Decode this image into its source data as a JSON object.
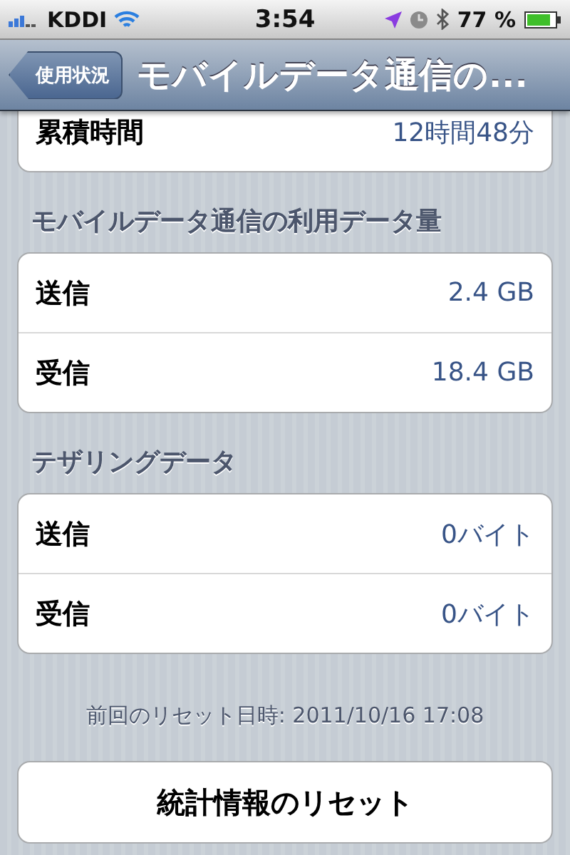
{
  "status_bar": {
    "carrier": "KDDI",
    "time": "3:54",
    "battery": "77 %"
  },
  "nav_bar": {
    "back": "使用状況",
    "title": "モバイルデータ通信の..."
  },
  "sections": [
    {
      "rows": [
        {
          "label": "累積時間",
          "value": "12時間48分"
        }
      ]
    },
    {
      "header": "モバイルデータ通信の利用データ量",
      "rows": [
        {
          "label": "送信",
          "value": "2.4 GB"
        },
        {
          "label": "受信",
          "value": "18.4 GB"
        }
      ]
    },
    {
      "header": "テザリングデータ",
      "rows": [
        {
          "label": "送信",
          "value": "0バイト"
        },
        {
          "label": "受信",
          "value": "0バイト"
        }
      ]
    }
  ],
  "footer": "前回のリセット日時: 2011/10/16 17:08",
  "reset_button": "統計情報のリセット"
}
